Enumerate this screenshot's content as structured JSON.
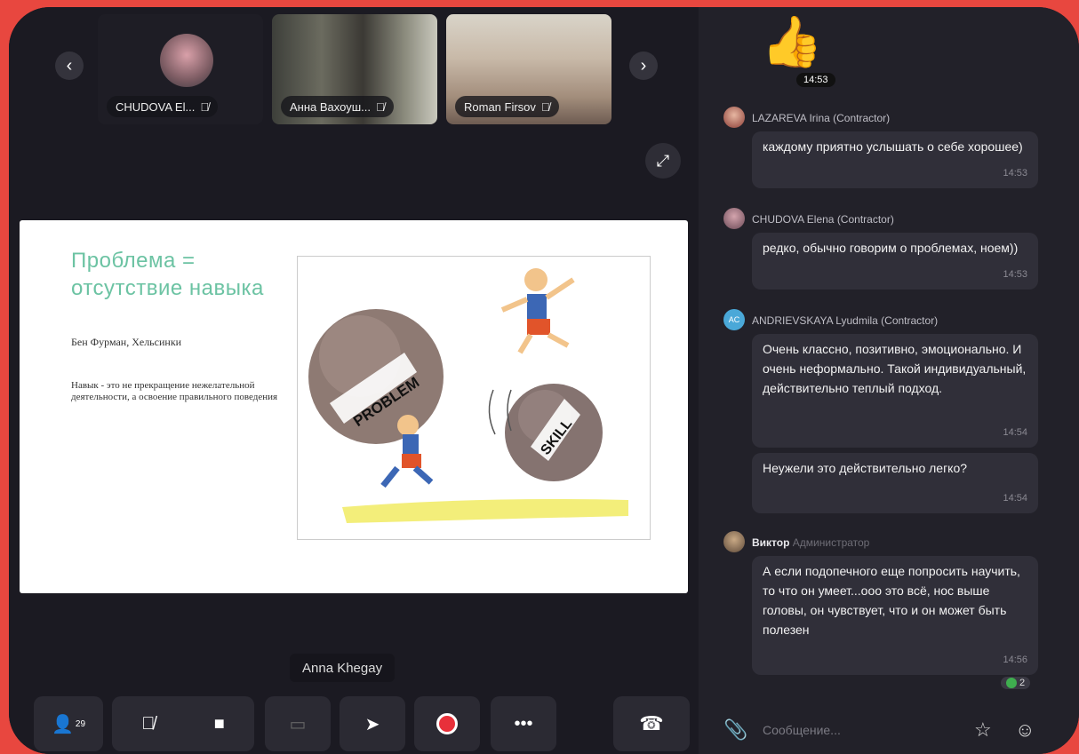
{
  "participants": [
    {
      "name": "CHUDOVA El...",
      "muted": true
    },
    {
      "name": "Анна Вахоуш...",
      "muted": true
    },
    {
      "name": "Roman Firsov",
      "muted": true
    }
  ],
  "stage": {
    "speaker_name": "Anna Khegay",
    "slide": {
      "title": "Проблема = отсутствие навыка",
      "author": "Бен Фурман, Хельсинки",
      "text": "Навык - это не прекращение нежелательной деятельности, а освоение правильного поведения",
      "word_problem": "PROBLEM",
      "word_skill": "SKILL"
    }
  },
  "reaction": {
    "time": "14:53"
  },
  "chat": {
    "messages": [
      {
        "author": "LAZAREVA Irina (Contractor)",
        "text": "каждому приятно услышать о себе хорошее)",
        "time": "14:53"
      },
      {
        "author": "CHUDOVA Elena (Contractor)",
        "text": "редко, обычно говорим о проблемах, ноем))",
        "time": "14:53"
      },
      {
        "author": "ANDRIEVSKAYA Lyudmila (Contractor)",
        "initials": "AC",
        "text": "Очень классно, позитивно, эмоционально. И очень неформально. Такой индивидуальный, действительно теплый подход.",
        "time": "14:54"
      },
      {
        "author": "",
        "text": "Неужели это действительно легко?",
        "time": "14:54"
      },
      {
        "author": "Виктор",
        "role": "Администратор",
        "text": "А если подопечного еще попросить научить, то что он умеет...ооо это всё, нос выше головы, он чувствует, что и он может быть полезен",
        "time": "14:56"
      }
    ],
    "reaction_count": "2",
    "input_placeholder": "Сообщение..."
  },
  "controls": {
    "participants_count": "29"
  }
}
